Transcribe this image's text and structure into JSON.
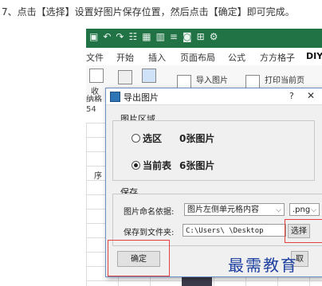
{
  "instruction": "7、点击【选择】设置好图片保存位置，然后点击【确定】即可完成。",
  "excel": {
    "tabs": [
      "文件",
      "开始",
      "插入",
      "页面布局",
      "公式",
      "方方格子",
      "DIY"
    ],
    "ribbon": {
      "import_label": "导入图片",
      "print_label": "打印当前页",
      "collect_label": "收",
      "collect_label2": "纳格"
    },
    "namebox": "54",
    "col_header": "序"
  },
  "dialog": {
    "title": "导出图片",
    "help": "?",
    "close": "✕",
    "region_group": "图片区域",
    "options": [
      {
        "label": "选区",
        "count": "0张图片",
        "checked": false
      },
      {
        "label": "当前表",
        "count": "6张图片",
        "checked": true
      }
    ],
    "save_group": "保存",
    "naming_label": "图片命名依据:",
    "naming_value": "图片左侧单元格内容",
    "format_value": ".png",
    "folder_label": "保存到文件夹:",
    "folder_value": "C:\\Users\\ \\Desktop",
    "select_button": "选择",
    "ok_button": "确定",
    "cancel_hint": "取"
  },
  "watermark": "最需教育"
}
